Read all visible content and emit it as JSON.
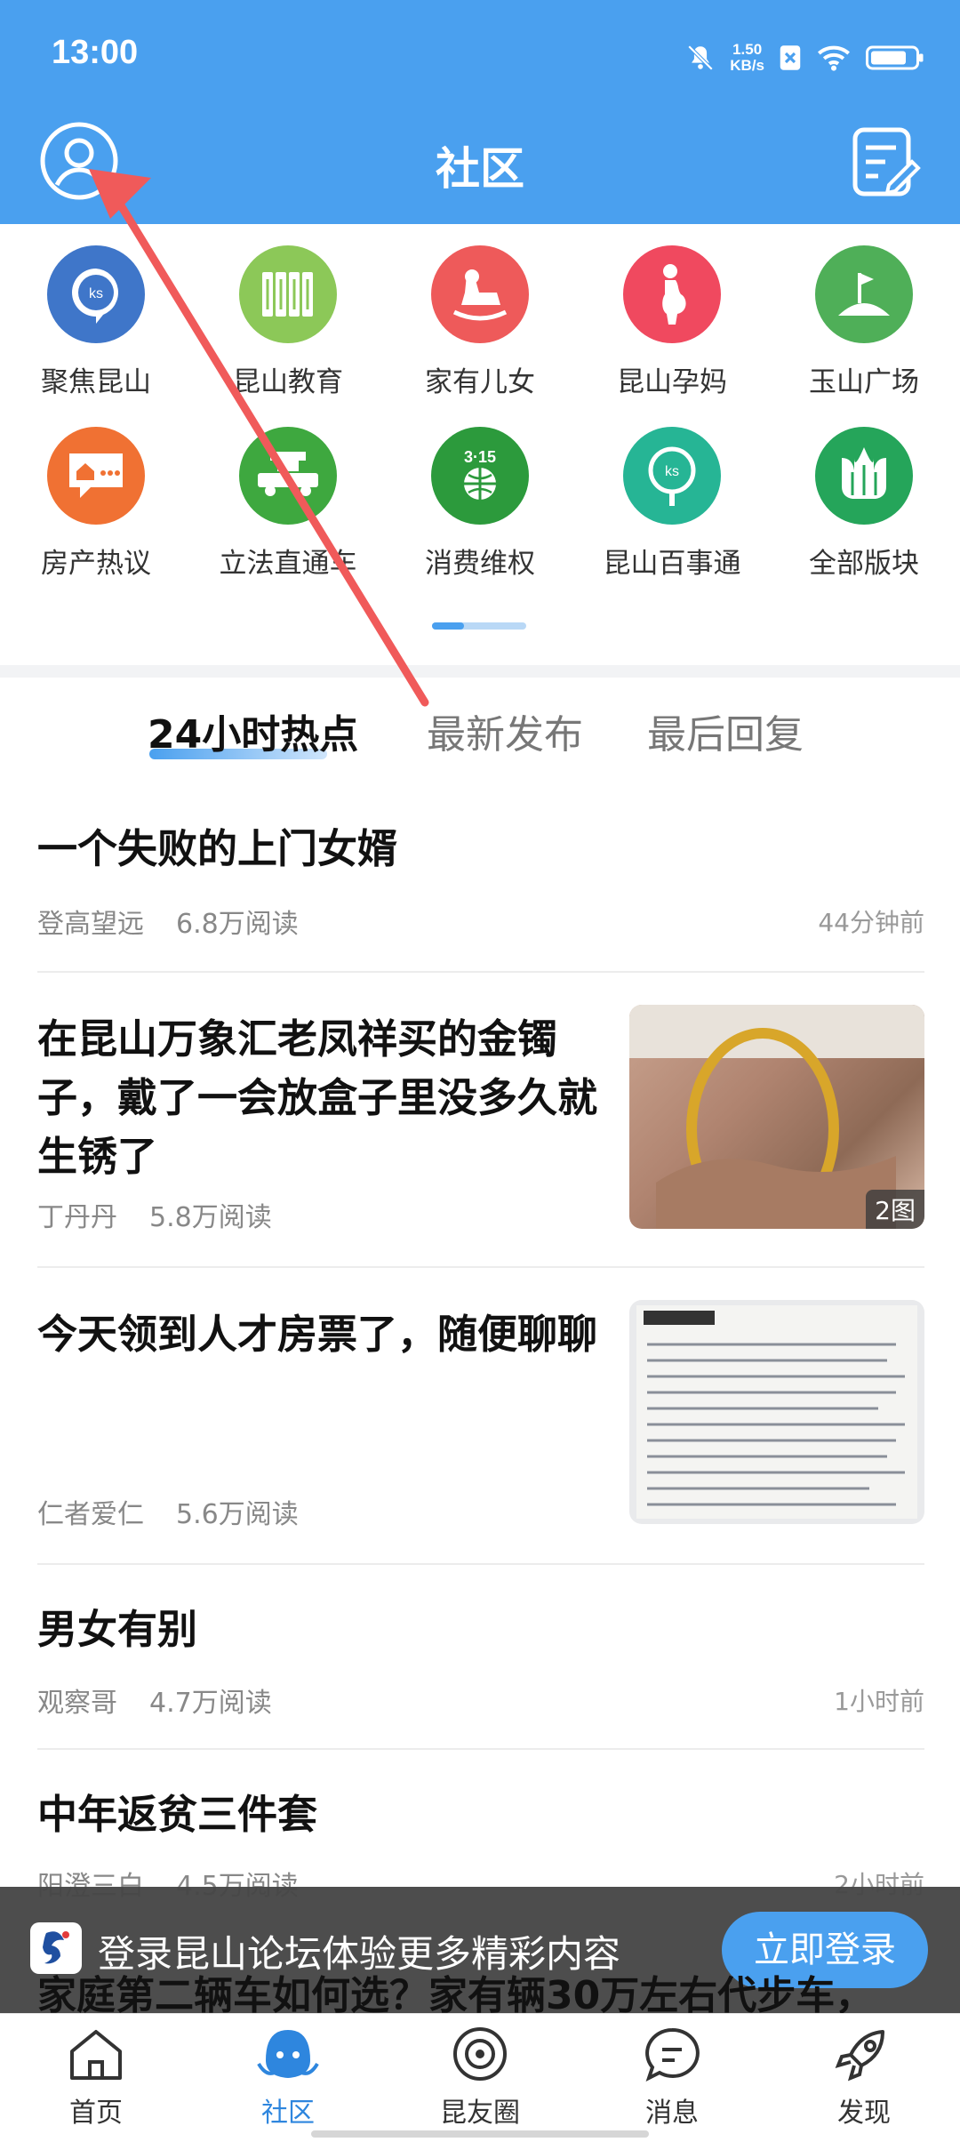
{
  "status": {
    "time": "13:00",
    "speed_value": "1.50",
    "speed_unit": "KB/s"
  },
  "header": {
    "title": "社区"
  },
  "categories": [
    {
      "label": "聚焦昆山",
      "icon": "ks-chat-icon",
      "color": "#3f76c9"
    },
    {
      "label": "昆山教育",
      "icon": "books-icon",
      "color": "#8cc858"
    },
    {
      "label": "家有儿女",
      "icon": "rocking-horse-icon",
      "color": "#ee5a5a"
    },
    {
      "label": "昆山孕妈",
      "icon": "pregnant-icon",
      "color": "#f0495f"
    },
    {
      "label": "玉山广场",
      "icon": "flag-hill-icon",
      "color": "#4faf58"
    },
    {
      "label": "房产热议",
      "icon": "house-chat-icon",
      "color": "#f07133"
    },
    {
      "label": "立法直通车",
      "icon": "law-bus-icon",
      "color": "#3ea83f"
    },
    {
      "label": "消费维权",
      "icon": "consumer-315-icon",
      "color": "#2c9a3c"
    },
    {
      "label": "昆山百事通",
      "icon": "ks-search-icon",
      "color": "#26b595"
    },
    {
      "label": "全部版块",
      "icon": "all-sections-icon",
      "color": "#25a55a"
    }
  ],
  "tabs": [
    "24小时热点",
    "最新发布",
    "最后回复"
  ],
  "posts": [
    {
      "title": "一个失败的上门女婿",
      "author": "登高望远",
      "reads": "6.8万阅读",
      "time": "44分钟前"
    },
    {
      "title": "在昆山万象汇老凤祥买的金镯子，戴了一会放盒子里没多久就生锈了",
      "author": "丁丹丹",
      "reads": "5.8万阅读",
      "image_count": "2图"
    },
    {
      "title": "今天领到人才房票了，随便聊聊",
      "author": "仁者爱仁",
      "reads": "5.6万阅读"
    },
    {
      "title": "男女有别",
      "author": "观察哥",
      "reads": "4.7万阅读",
      "time": "1小时前"
    },
    {
      "title": "中年返贫三件套",
      "author": "阳澄三白",
      "reads": "4.5万阅读",
      "time": "2小时前"
    },
    {
      "title": "家庭第二辆车如何选？家有辆30万左右代步车，"
    }
  ],
  "banner": {
    "text": "登录昆山论坛体验更多精彩内容",
    "button": "立即登录"
  },
  "bottom_nav": [
    {
      "label": "首页",
      "icon": "home-icon"
    },
    {
      "label": "社区",
      "icon": "community-icon",
      "active": true
    },
    {
      "label": "昆友圈",
      "icon": "planet-icon"
    },
    {
      "label": "消息",
      "icon": "message-icon"
    },
    {
      "label": "发现",
      "icon": "rocket-icon"
    }
  ],
  "colors": {
    "primary": "#4aa0ef",
    "arrow": "#f05a5a"
  }
}
